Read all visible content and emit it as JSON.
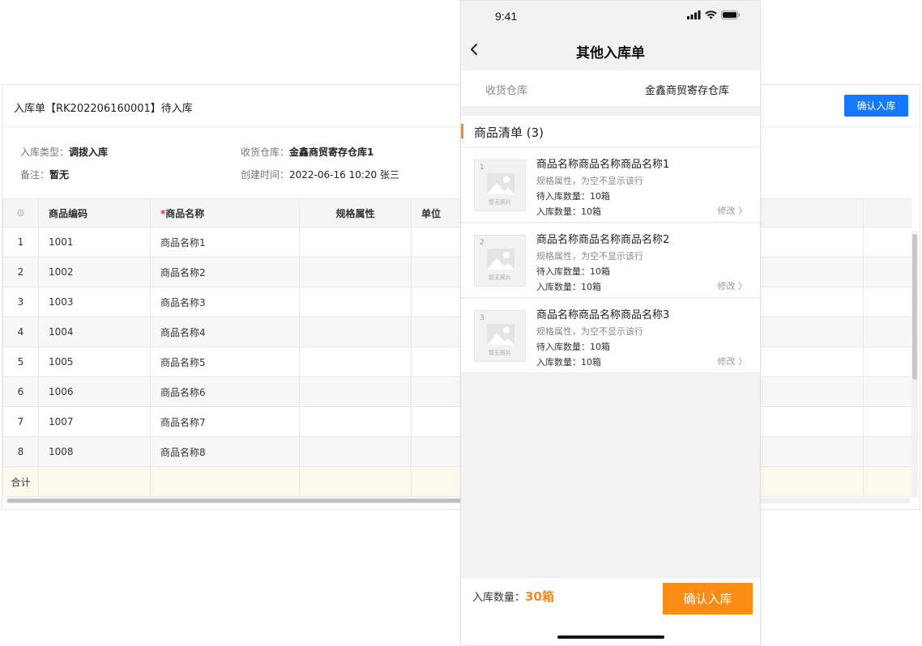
{
  "desktop": {
    "title": "入库单【RK202206160001】待入库",
    "confirm_button": "确认入库",
    "meta": {
      "type_key": "入库类型：",
      "type_val": "调拨入库",
      "warehouse_key": "收货仓库：",
      "warehouse_val": "金鑫商贸寄存仓库1",
      "remark_key": "备注：",
      "remark_val": "暂无",
      "created_key": "创建时间：",
      "created_val": "2022-06-16 10:20 张三"
    },
    "table": {
      "headers": {
        "code": "商品编码",
        "required_mark": "*",
        "name": "商品名称",
        "spec": "规格属性",
        "unit": "单位"
      },
      "rows": [
        {
          "idx": "1",
          "code": "1001",
          "name": "商品名称1"
        },
        {
          "idx": "2",
          "code": "1002",
          "name": "商品名称2"
        },
        {
          "idx": "3",
          "code": "1003",
          "name": "商品名称3"
        },
        {
          "idx": "4",
          "code": "1004",
          "name": "商品名称4"
        },
        {
          "idx": "5",
          "code": "1005",
          "name": "商品名称5"
        },
        {
          "idx": "6",
          "code": "1006",
          "name": "商品名称6"
        },
        {
          "idx": "7",
          "code": "1007",
          "name": "商品名称7"
        },
        {
          "idx": "8",
          "code": "1008",
          "name": "商品名称8"
        }
      ],
      "total_label": "合计"
    }
  },
  "mobile": {
    "status_time": "9:41",
    "nav_title": "其他入库单",
    "warehouse_key": "收货仓库",
    "warehouse_val": "金鑫商贸寄存仓库",
    "list_title": "商品清单 (3)",
    "items": [
      {
        "no": "1",
        "name": "商品名称商品名称商品名称1",
        "spec": "规格属性，为空不显示该行",
        "pending": "待入库数量：10箱",
        "inbound": "入库数量：10箱",
        "edit": "修改 〉",
        "no_photo": "暂无照片"
      },
      {
        "no": "2",
        "name": "商品名称商品名称商品名称2",
        "spec": "规格属性，为空不显示该行",
        "pending": "待入库数量：10箱",
        "inbound": "入库数量：10箱",
        "edit": "修改 〉",
        "no_photo": "暂无照片"
      },
      {
        "no": "3",
        "name": "商品名称商品名称商品名称3",
        "spec": "规格属性，为空不显示该行",
        "pending": "待入库数量：10箱",
        "inbound": "入库数量：10箱",
        "edit": "修改 〉",
        "no_photo": "暂无照片"
      }
    ],
    "bottom": {
      "label": "入库数量：",
      "qty": "30箱",
      "button": "确认入库"
    },
    "colors": {
      "accent": "#fa8c16",
      "primary": "#1677ff"
    }
  }
}
